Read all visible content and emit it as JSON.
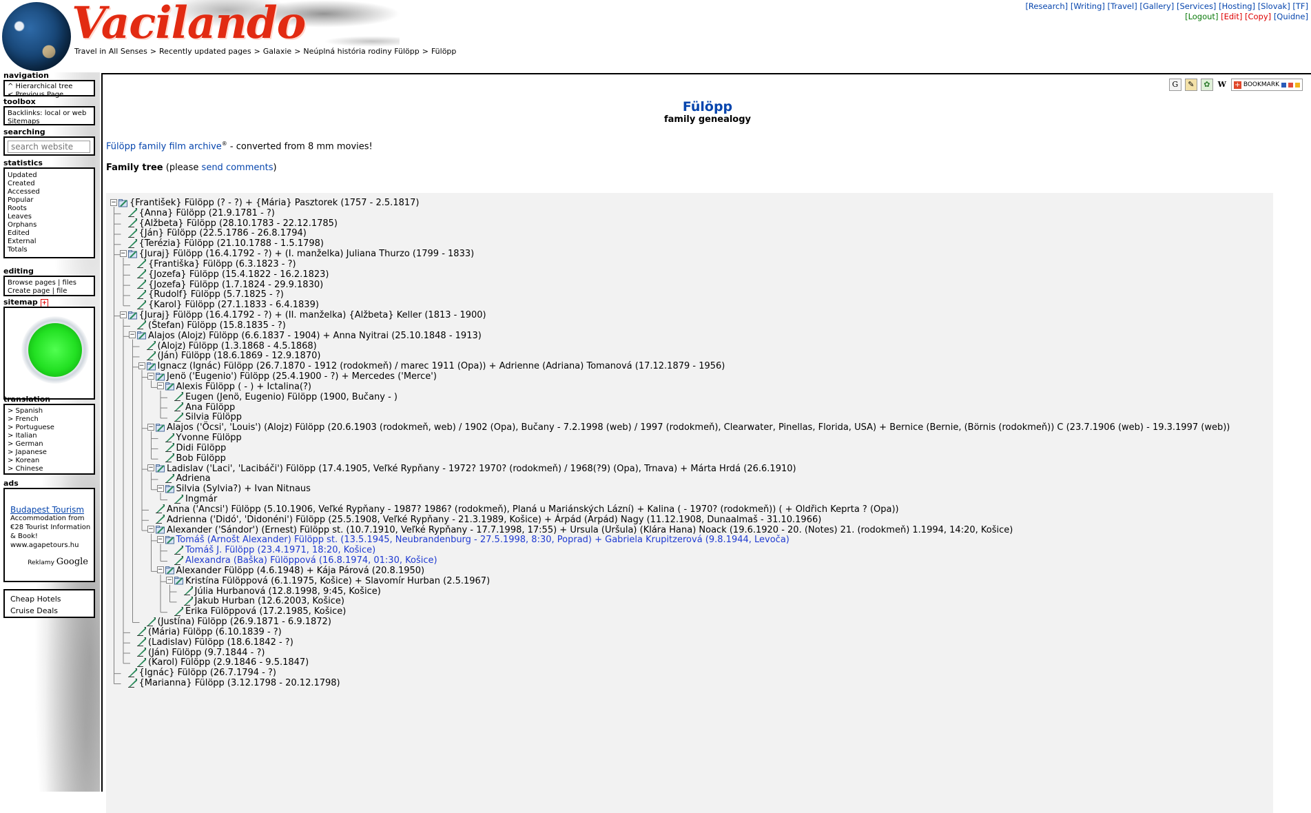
{
  "site": {
    "logo": "Vacilando",
    "breadcrumb": [
      "Travel in All Senses",
      "Recently updated pages",
      "Galaxie",
      "Neúplná história rodiny Fülöpp",
      "Fülöpp"
    ]
  },
  "toplinks": {
    "row1": [
      "Research",
      "Writing",
      "Travel",
      "Gallery",
      "Services",
      "Hosting",
      "Slovak",
      "TF"
    ],
    "row2": [
      {
        "label": "Logout",
        "color": "#0a7a0a"
      },
      {
        "label": "Edit",
        "color": "#dd0000"
      },
      {
        "label": "Copy",
        "color": "#dd0000"
      },
      {
        "label": "Quidne",
        "color": "#0645ad"
      }
    ]
  },
  "sidebar": {
    "navigation": {
      "title": "navigation",
      "items": [
        "^ Hierarchical tree",
        "< Previous Page"
      ]
    },
    "toolbox": {
      "title": "toolbox",
      "items": [
        "Backlinks: local or web",
        "Sitemaps"
      ]
    },
    "searching": {
      "title": "searching",
      "placeholder": "search website"
    },
    "statistics": {
      "title": "statistics",
      "items": [
        "Updated",
        "Created",
        "Accessed",
        "Popular",
        "Roots",
        "Leaves",
        "Orphans",
        "Edited",
        "External",
        "Totals"
      ]
    },
    "editing": {
      "title": "editing",
      "row1a": "Browse pages",
      "row1b": "files",
      "row2a": "Create page",
      "row2b": "file"
    },
    "sitemap": {
      "title": "sitemap",
      "toggle": "+"
    },
    "translation": {
      "title": "translation",
      "items": [
        "> Spanish",
        "> French",
        "> Portuguese",
        "> Italian",
        "> German",
        "> Japanese",
        "> Korean",
        "> Chinese"
      ]
    },
    "ads": {
      "title": "ads",
      "ad_title": "Budapest Tourism",
      "ad_lines": [
        "Accommodation from",
        "€28 Tourist Information",
        "& Book!",
        "www.agapetours.hu"
      ],
      "reklamy": "Reklamy",
      "google": "Google"
    },
    "links": [
      "Cheap Hotels",
      "Cruise Deals"
    ]
  },
  "main": {
    "bookmark_label": "BOOKMARK",
    "title": "Fülöpp",
    "subtitle": "family genealogy",
    "intro_link": "Fülöpp family film archive",
    "intro_sup": "®",
    "intro_rest": " - converted from 8 mm movies!",
    "family_label": "Family tree",
    "family_pre": " (please ",
    "family_link": "send comments",
    "family_post": ")"
  },
  "tree": [
    {
      "d": 0,
      "t": 1,
      "text": "{František} Fülöpp (? - ?) + {Mária} Pasztorek (1757 - 2.5.1817)"
    },
    {
      "d": 1,
      "t": 0,
      "text": "{Anna} Fülöpp (21.9.1781 - ?)"
    },
    {
      "d": 1,
      "t": 0,
      "text": "{Alžbeta} Fülöpp (28.10.1783 - 22.12.1785)"
    },
    {
      "d": 1,
      "t": 0,
      "text": "{Ján} Fülöpp (22.5.1786 - 26.8.1794)"
    },
    {
      "d": 1,
      "t": 0,
      "text": "{Terézia} Fülöpp (21.10.1788 - 1.5.1798)"
    },
    {
      "d": 1,
      "t": 1,
      "text": "{Juraj} Fülöpp (16.4.1792 - ?) + (I. manželka) Juliana Thurzo (1799 - 1833)"
    },
    {
      "d": 2,
      "t": 0,
      "text": "{Františka} Fülöpp (6.3.1823 - ?)"
    },
    {
      "d": 2,
      "t": 0,
      "text": "{Jozefa} Fülöpp (15.4.1822 - 16.2.1823)"
    },
    {
      "d": 2,
      "t": 0,
      "text": "{Jozefa} Fülöpp (1.7.1824 - 29.9.1830)"
    },
    {
      "d": 2,
      "t": 0,
      "text": "{Rudolf} Fülöpp (5.7.1825 - ?)"
    },
    {
      "d": 2,
      "t": 0,
      "text": "{Karol} Fülöpp (27.1.1833 - 6.4.1839)"
    },
    {
      "d": 1,
      "t": 1,
      "text": "{Juraj} Fülöpp (16.4.1792 - ?) + (II. manželka) {Alžbeta} Keller (1813 - 1900)"
    },
    {
      "d": 2,
      "t": 0,
      "text": "(Štefan) Fülöpp (15.8.1835 - ?)"
    },
    {
      "d": 2,
      "t": 1,
      "text": "Alajos (Alojz) Fülöpp (6.6.1837 - 1904) + Anna Nyitrai (25.10.1848 - 1913)"
    },
    {
      "d": 3,
      "t": 0,
      "text": "(Alojz) Fülöpp (1.3.1868 - 4.5.1868)"
    },
    {
      "d": 3,
      "t": 0,
      "text": "(Ján) Fülöpp (18.6.1869 - 12.9.1870)"
    },
    {
      "d": 3,
      "t": 1,
      "text": "Ignacz (Ignác) Fülöpp (26.7.1870 - 1912 (rodokmeň) / marec 1911 (Opa)) + Adrienne (Adriana) Tomanová (17.12.1879 - 1956)"
    },
    {
      "d": 4,
      "t": 1,
      "text": "Jenö ('Eugenio') Fülöpp (25.4.1900 - ?) + Mercedes ('Merce')"
    },
    {
      "d": 5,
      "t": 1,
      "text": "Alexis Fülöpp ( - ) + Ictalina(?)"
    },
    {
      "d": 6,
      "t": 0,
      "text": "Eugen (Jenö, Eugenio) Fülöpp (1900, Bučany - )"
    },
    {
      "d": 6,
      "t": 0,
      "text": "Ana Fülöpp"
    },
    {
      "d": 6,
      "t": 0,
      "text": "Silvia Fülöpp"
    },
    {
      "d": 4,
      "t": 1,
      "text": "Alajos ('Öcsi', 'Louis') (Alojz) Fülöpp (20.6.1903 (rodokmeň, web) / 1902 (Opa), Bučany - 7.2.1998 (web) / 1997 (rodokmeň), Clearwater, Pinellas, Florida, USA) + Bernice (Bernie, (Börnis (rodokmeň)) C (23.7.1906 (web) - 19.3.1997 (web))"
    },
    {
      "d": 5,
      "t": 0,
      "text": "Yvonne Fülöpp"
    },
    {
      "d": 5,
      "t": 0,
      "text": "Didi Fülöpp"
    },
    {
      "d": 5,
      "t": 0,
      "text": "Bob Fülöpp"
    },
    {
      "d": 4,
      "t": 1,
      "text": "Ladislav ('Laci', 'Lacibáči') Fülöpp (17.4.1905, Veľké Rypňany - 1972? 1970? (rodokmeň) / 1968(?9) (Opa), Trnava) + Márta Hrdá (26.6.1910)"
    },
    {
      "d": 5,
      "t": 0,
      "text": "Adriena"
    },
    {
      "d": 5,
      "t": 1,
      "text": "Silvia (Sylvia?) + Ivan Nitnaus"
    },
    {
      "d": 6,
      "t": 0,
      "text": "Ingmár"
    },
    {
      "d": 4,
      "t": 0,
      "text": "Anna ('Ancsi') Fülöpp (5.10.1906, Veľké Rypňany - 1987? 1986? (rodokmeň), Planá u Mariánských Lázní) + Kalina ( - 1970? (rodokmeň)) ( + Oldřich Keprta ? (Opa))"
    },
    {
      "d": 4,
      "t": 0,
      "text": "Adrienna ('Didó', 'Didonéni') Fülöpp (25.5.1908, Veľké Rypňany - 21.3.1989, Košice) + Árpád (Arpád) Nagy (11.12.1908, Dunaalmaš - 31.10.1966)"
    },
    {
      "d": 4,
      "t": 1,
      "text": "Alexander ('Sándor') (Ernest) Fülöpp st. (10.7.1910, Veľké Rypňany - 17.7.1998, 17:55) + Ursula (Uršula) (Klára Hana) Noack (19.6.1920 - 20. (Notes) 21. (rodokmeň) 1.1994, 14:20, Košice)"
    },
    {
      "d": 5,
      "t": 1,
      "hl": 1,
      "text": "Tomáš (Arnošt Alexander) Fülöpp st. (13.5.1945, Neubrandenburg - 27.5.1998, 8:30, Poprad) + Gabriela Krupitzerová (9.8.1944, Levoča)"
    },
    {
      "d": 6,
      "t": 0,
      "hl": 1,
      "text": "Tomáš J. Fülöpp (23.4.1971, 18:20, Košice)"
    },
    {
      "d": 6,
      "t": 0,
      "hl": 1,
      "text": "Alexandra (Baška) Fülöppová (16.8.1974, 01:30, Košice)"
    },
    {
      "d": 5,
      "t": 1,
      "text": "Alexander Fülöpp (4.6.1948) + Kája Párová (20.8.1950)"
    },
    {
      "d": 6,
      "t": 1,
      "text": "Kristína Fülöppová (6.1.1975, Košice) + Slavomír Hurban (2.5.1967)"
    },
    {
      "d": 7,
      "t": 0,
      "text": "Júlia Hurbanová (12.8.1998, 9:45, Košice)"
    },
    {
      "d": 7,
      "t": 0,
      "text": "Jakub Hurban (12.6.2003, Košice)"
    },
    {
      "d": 6,
      "t": 0,
      "text": "Erika Fülöppová (17.2.1985, Košice)"
    },
    {
      "d": 3,
      "t": 0,
      "text": "(Justína) Fülöpp (26.9.1871 - 6.9.1872)"
    },
    {
      "d": 2,
      "t": 0,
      "text": "(Mária) Fülöpp (6.10.1839 - ?)"
    },
    {
      "d": 2,
      "t": 0,
      "text": "(Ladislav) Fülöpp (18.6.1842 - ?)"
    },
    {
      "d": 2,
      "t": 0,
      "text": "(Ján) Fülöpp (9.7.1844 - ?)"
    },
    {
      "d": 2,
      "t": 0,
      "text": "(Karol) Fülöpp (2.9.1846 - 9.5.1847)"
    },
    {
      "d": 1,
      "t": 0,
      "text": "{Ignác} Fülöpp (26.7.1794 - ?)"
    },
    {
      "d": 1,
      "t": 0,
      "text": "{Marianna} Fülöpp (3.12.1798 - 20.12.1798)"
    }
  ]
}
